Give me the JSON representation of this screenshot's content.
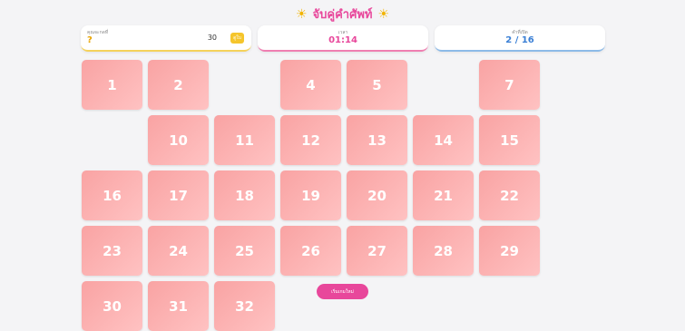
{
  "title": "จับคู่คำศัพท์",
  "stats": {
    "hint_label": "คุณจะกดที่",
    "hint_value": "?",
    "hint_count": "30",
    "hint_button": "ดูใบ",
    "time_label": "เวลา",
    "time_value": "01:14",
    "matched_label": "คำที่เปิด",
    "matched_value": "2 / 16"
  },
  "cards": [
    "1",
    "2",
    "",
    "4",
    "5",
    "",
    "7",
    "",
    "10",
    "11",
    "12",
    "13",
    "14",
    "15",
    "16",
    "17",
    "18",
    "19",
    "20",
    "21",
    "22",
    "23",
    "24",
    "25",
    "26",
    "27",
    "28",
    "29",
    "30",
    "31",
    "32"
  ],
  "restart_label": "เริ่มเกมใหม่",
  "colors": {
    "accent": "#e8479b",
    "card_from": "#f9a3a3",
    "card_to": "#ffc2c2",
    "timer_text": "#e8479b",
    "matched_text": "#3a7fd5",
    "hint_text": "#e8a300",
    "hint_button": "#f5c52b"
  }
}
